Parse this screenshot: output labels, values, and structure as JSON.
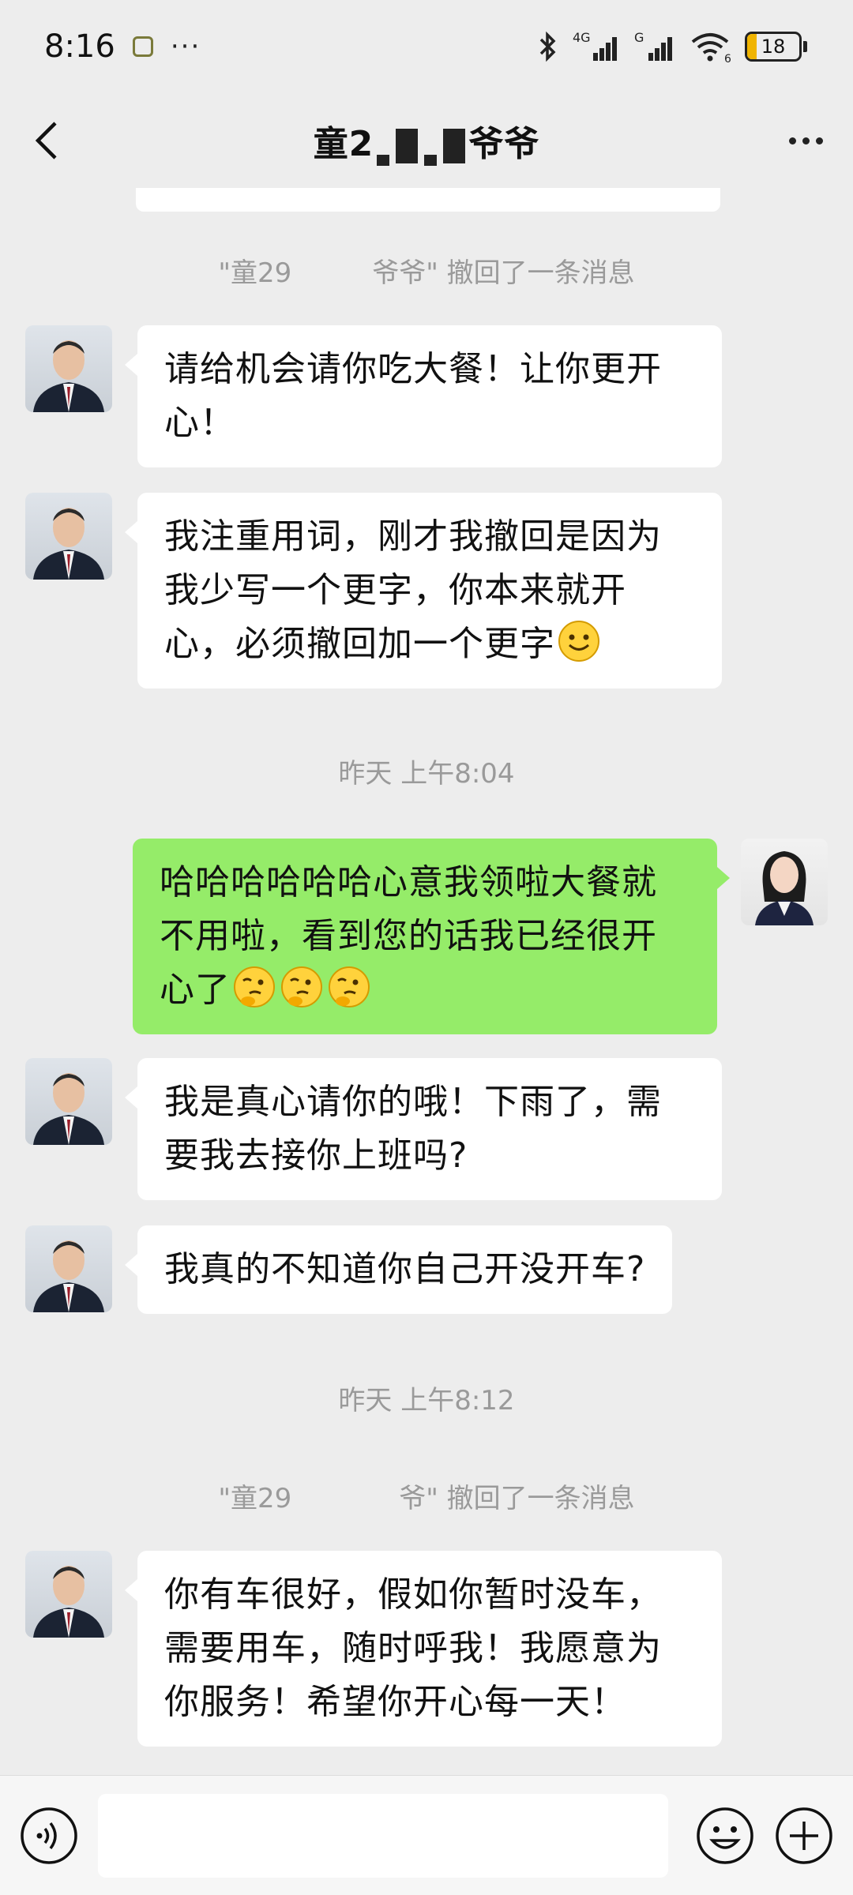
{
  "status_bar": {
    "time": "8:16",
    "dots": "···",
    "network_4g": "4G",
    "network_g": "G",
    "wifi_sub": "6",
    "battery": "18",
    "battery_level": 0.18
  },
  "header": {
    "title_prefix": "童2",
    "title_suffix": "爷爷",
    "back_icon": "chevron-left-icon",
    "more_icon": "more-horizontal-icon"
  },
  "messages": {
    "recall_1": "\"童29   爷爷\" 撤回了一条消息",
    "m1": "请给机会请你吃大餐！让你更开心！",
    "m2": "我注重用词，刚才我撤回是因为我少写一个更字，你本来就开心，必须撤回加一个更字",
    "time_1": "昨天 上午8:04",
    "m3": "哈哈哈哈哈哈心意我领啦大餐就不用啦，看到您的话我已经很开心了",
    "m4": "我是真心请你的哦！下雨了，需要我去接你上班吗?",
    "m5": "我真的不知道你自己开没开车?",
    "time_2": "昨天 上午8:12",
    "recall_2": "\"童29    爷\" 撤回了一条消息",
    "m6": "你有车很好，假如你暂时没车，需要用车，随时呼我！我愿意为你服务！希望你开心每一天！"
  },
  "input_bar": {
    "voice_icon": "voice-icon",
    "emoji_icon": "emoji-icon",
    "plus_icon": "plus-circle-icon",
    "placeholder": ""
  },
  "colors": {
    "background": "#ededed",
    "bubble_left": "#ffffff",
    "bubble_right": "#95ec69",
    "system_text": "#9a9a9a"
  }
}
